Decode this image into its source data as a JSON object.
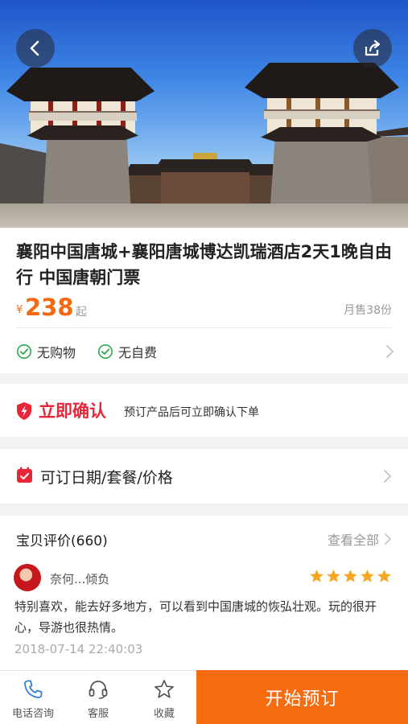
{
  "header": {
    "back_icon": "chevron-left-icon",
    "share_icon": "share-icon"
  },
  "product": {
    "title": "襄阳中国唐城+襄阳唐城博达凯瑞酒店2天1晚自由行 中国唐朝门票",
    "currency": "¥",
    "price": "238",
    "price_suffix": "起",
    "monthly_sales": "月售38份",
    "tags": [
      {
        "label": "无购物",
        "icon": "check-circle-icon"
      },
      {
        "label": "无自费",
        "icon": "check-circle-icon"
      }
    ]
  },
  "confirm": {
    "title": "立即确认",
    "description": "预订产品后可立即确认下单",
    "icon": "shield-bolt-icon"
  },
  "date_selector": {
    "label": "可订日期/套餐/价格",
    "icon": "calendar-icon"
  },
  "reviews": {
    "heading": "宝贝评价(660)",
    "view_all": "查看全部",
    "items": [
      {
        "reviewer": "奈何...倾负",
        "rating": 5,
        "text": "特别喜欢，能去好多地方，可以看到中国唐城的恢弘壮观。玩的很开心，导游也很热情。",
        "time": "2018-07-14 22:40:03"
      }
    ]
  },
  "bottom_bar": {
    "items": [
      {
        "label": "电话咨询",
        "icon": "phone-icon"
      },
      {
        "label": "客服",
        "icon": "headset-icon"
      },
      {
        "label": "收藏",
        "icon": "star-outline-icon"
      }
    ],
    "book_button": "开始预订"
  },
  "colors": {
    "accent": "#f86c11",
    "price": "#f36a12",
    "confirm_red": "#e8263a",
    "check_green": "#2fa84f",
    "star": "#f5a623"
  }
}
